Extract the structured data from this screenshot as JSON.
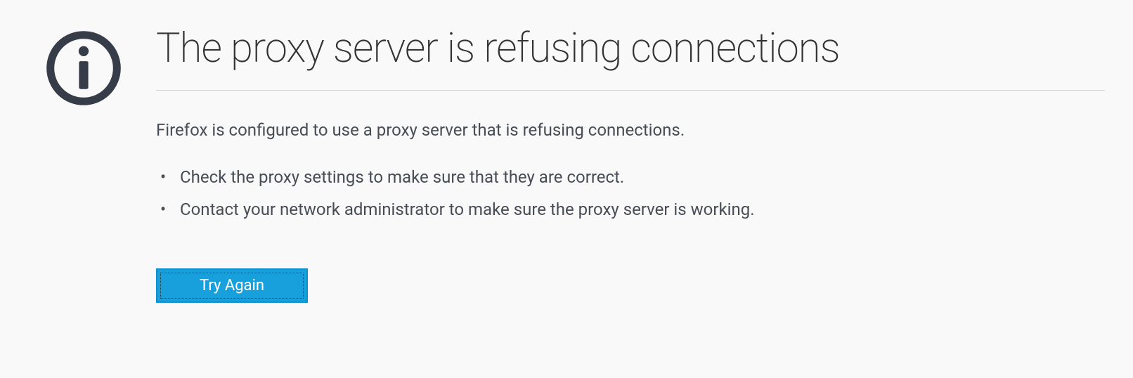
{
  "error": {
    "title": "The proxy server is refusing connections",
    "description": "Firefox is configured to use a proxy server that is refusing connections.",
    "suggestions": [
      "Check the proxy settings to make sure that they are correct.",
      "Contact your network administrator to make sure the proxy server is working."
    ],
    "retry_label": "Try Again"
  }
}
